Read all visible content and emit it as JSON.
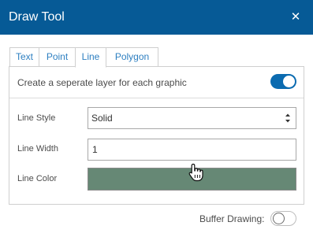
{
  "window": {
    "title": "Draw Tool",
    "close_icon": "close-icon"
  },
  "tabs": [
    {
      "label": "Text",
      "active": false
    },
    {
      "label": "Point",
      "active": false
    },
    {
      "label": "Line",
      "active": true
    },
    {
      "label": "Polygon",
      "active": false
    }
  ],
  "panel": {
    "separate_layer_label": "Create a seperate layer for each graphic",
    "separate_layer_on": true,
    "line_style": {
      "label": "Line Style",
      "value": "Solid"
    },
    "line_width": {
      "label": "Line Width",
      "value": "1"
    },
    "line_color": {
      "label": "Line Color",
      "color": "#668875"
    }
  },
  "buffer": {
    "label": "Buffer Drawing:",
    "on": false
  },
  "colors": {
    "accent": "#065a96",
    "tab_text": "#2d7fc1",
    "toggle_on": "#0b6bb0"
  }
}
